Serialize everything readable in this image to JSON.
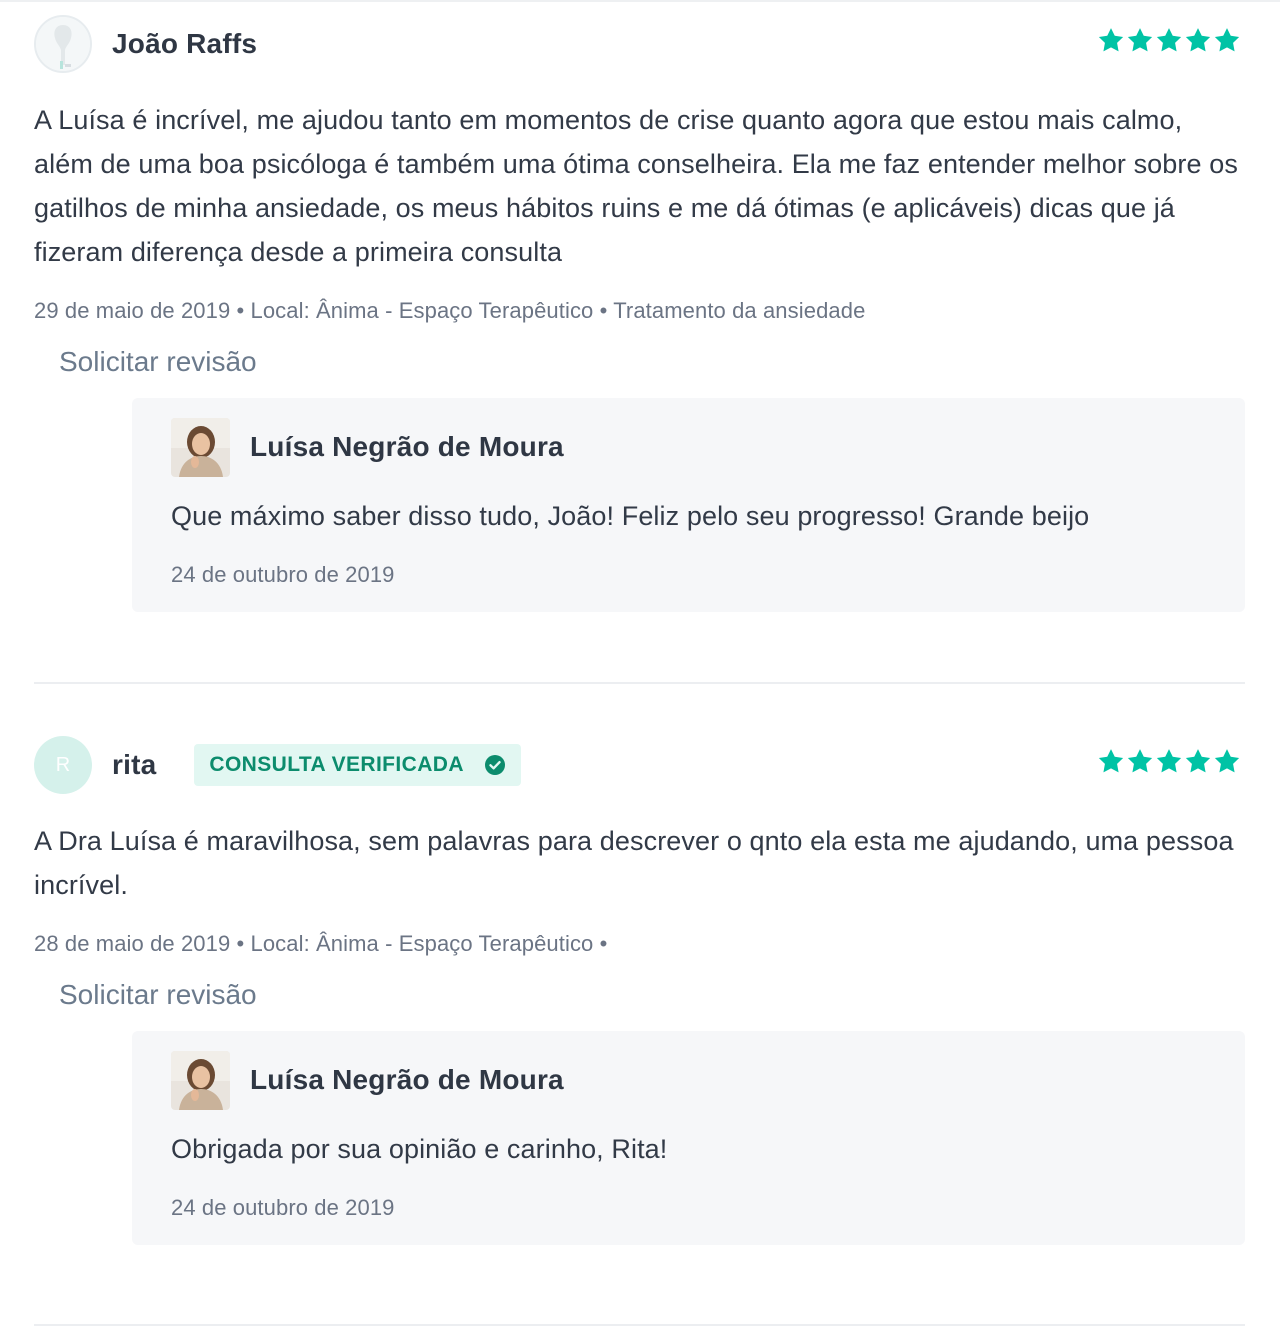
{
  "colors": {
    "accent": "#00c3a5",
    "badge_bg": "#e2f7f2",
    "badge_text": "#0c8c6d",
    "reply_bg": "#f6f7f9",
    "meta_text": "#6b7484"
  },
  "reviews": [
    {
      "author": "João Raffs",
      "avatar": {
        "type": "image",
        "icon": "default-user-avatar-icon"
      },
      "verified": false,
      "rating": 5,
      "body": "A Luísa é incrível, me ajudou tanto em momentos de crise quanto agora que estou mais calmo, além de uma boa psicóloga é também uma ótima conselheira. Ela me faz entender melhor sobre os gatilhos de minha ansiedade, os meus hábitos ruins e me dá ótimas (e aplicáveis) dicas que já fizeram diferença desde a primeira consulta",
      "meta": "29 de maio de 2019 • Local: Ânima - Espaço Terapêutico • Tratamento da ansiedade",
      "request_revision": "Solicitar revisão",
      "reply": {
        "author": "Luísa Negrão de Moura",
        "body": "Que máximo saber disso tudo, João! Feliz pelo seu progresso! Grande beijo",
        "date": "24 de outubro de 2019"
      }
    },
    {
      "author": "rita",
      "avatar": {
        "type": "initial",
        "initial": "R"
      },
      "verified": true,
      "verified_label": "CONSULTA VERIFICADA",
      "rating": 5,
      "body": "A Dra Luísa é maravilhosa, sem palavras para descrever o qnto ela esta me ajudando, uma pessoa incrível.",
      "meta": "28 de maio de 2019 • Local: Ânima - Espaço Terapêutico •",
      "request_revision": "Solicitar revisão",
      "reply": {
        "author": "Luísa Negrão de Moura",
        "body": "Obrigada por sua opinião e carinho, Rita!",
        "date": "24 de outubro de 2019"
      }
    }
  ]
}
